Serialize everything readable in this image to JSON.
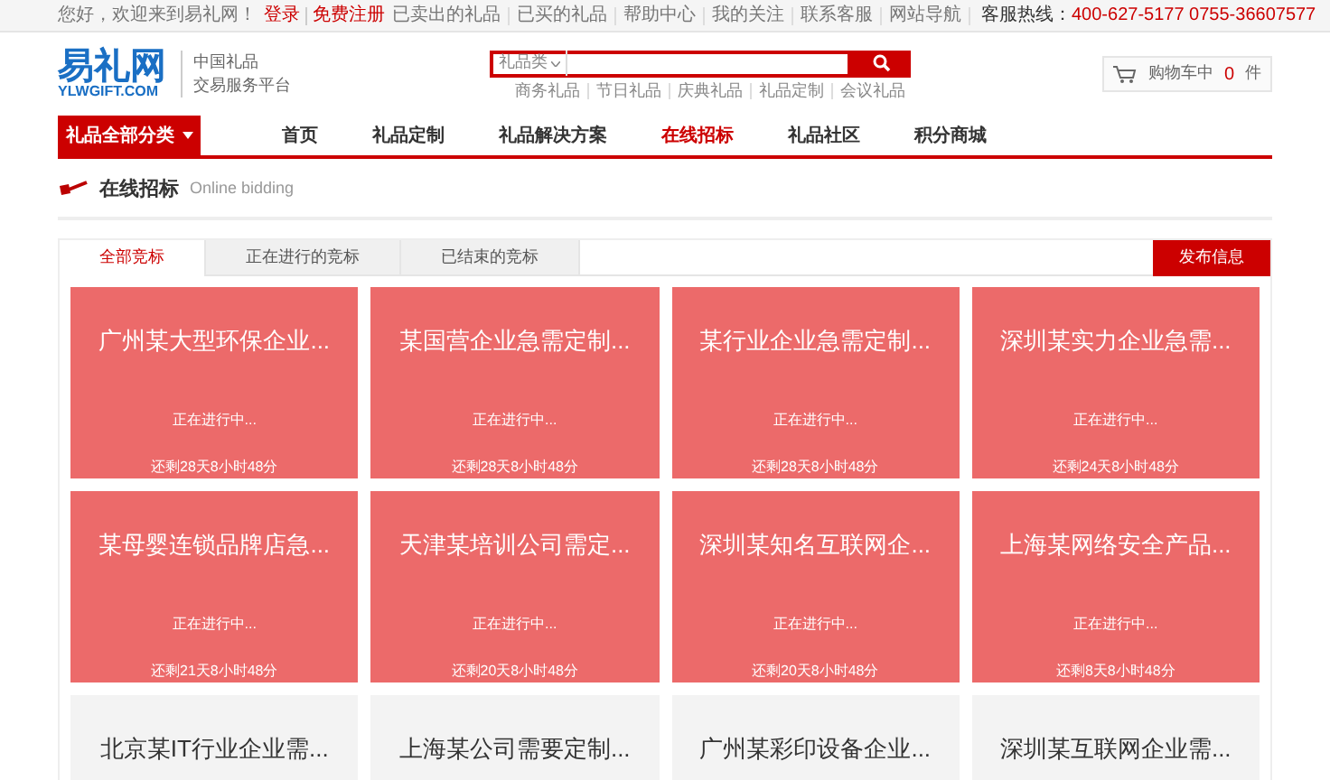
{
  "top_bar": {
    "greeting": "您好，欢迎来到易礼网！",
    "login": "登录",
    "register": "免费注册",
    "links": [
      "已卖出的礼品",
      "已买的礼品",
      "帮助中心",
      "我的关注",
      "联系客服",
      "网站导航"
    ],
    "hotline_label": "客服热线：",
    "hotline": "400-627-5177 0755-36607577"
  },
  "header": {
    "logo": "易礼网",
    "logo_sub": "YLWGIFT.COM",
    "tagline": [
      "中国礼品",
      "交易服务平台"
    ],
    "search": {
      "category": "礼品类"
    },
    "hot_words": [
      "商务礼品",
      "节日礼品",
      "庆典礼品",
      "礼品定制",
      "会议礼品"
    ],
    "cart": {
      "label": "购物车中",
      "count": "0",
      "unit": "件"
    }
  },
  "nav": {
    "category_button": "礼品全部分类",
    "items": [
      {
        "label": "首页",
        "selected": false
      },
      {
        "label": "礼品定制",
        "selected": false
      },
      {
        "label": "礼品解决方案",
        "selected": false
      },
      {
        "label": "在线招标",
        "selected": true
      },
      {
        "label": "礼品社区",
        "selected": false
      },
      {
        "label": "积分商城",
        "selected": false
      }
    ]
  },
  "section": {
    "title": "在线招标",
    "subtitle": "Online bidding"
  },
  "tabs": [
    {
      "label": "全部竞标",
      "selected": true
    },
    {
      "label": "正在进行的竞标",
      "selected": false
    },
    {
      "label": "已结束的竞标",
      "selected": false
    }
  ],
  "publish_button": "发布信息",
  "cards": [
    {
      "kind": "active",
      "title": "广州某大型环保企业...",
      "status": "正在进行中...",
      "remaining": "还剩28天8小时48分"
    },
    {
      "kind": "active",
      "title": "某国营企业急需定制...",
      "status": "正在进行中...",
      "remaining": "还剩28天8小时48分"
    },
    {
      "kind": "active",
      "title": "某行业企业急需定制...",
      "status": "正在进行中...",
      "remaining": "还剩28天8小时48分"
    },
    {
      "kind": "active",
      "title": "深圳某实力企业急需...",
      "status": "正在进行中...",
      "remaining": "还剩24天8小时48分"
    },
    {
      "kind": "active",
      "title": "某母婴连锁品牌店急...",
      "status": "正在进行中...",
      "remaining": "还剩21天8小时48分"
    },
    {
      "kind": "active",
      "title": "天津某培训公司需定...",
      "status": "正在进行中...",
      "remaining": "还剩20天8小时48分"
    },
    {
      "kind": "active",
      "title": "深圳某知名互联网企...",
      "status": "正在进行中...",
      "remaining": "还剩20天8小时48分"
    },
    {
      "kind": "active",
      "title": "上海某网络安全产品...",
      "status": "正在进行中...",
      "remaining": "还剩8天8小时48分"
    },
    {
      "kind": "ended",
      "title": "北京某IT行业企业需..."
    },
    {
      "kind": "ended",
      "title": "上海某公司需要定制..."
    },
    {
      "kind": "ended",
      "title": "广州某彩印设备企业..."
    },
    {
      "kind": "ended",
      "title": "深圳某互联网企业需..."
    }
  ]
}
